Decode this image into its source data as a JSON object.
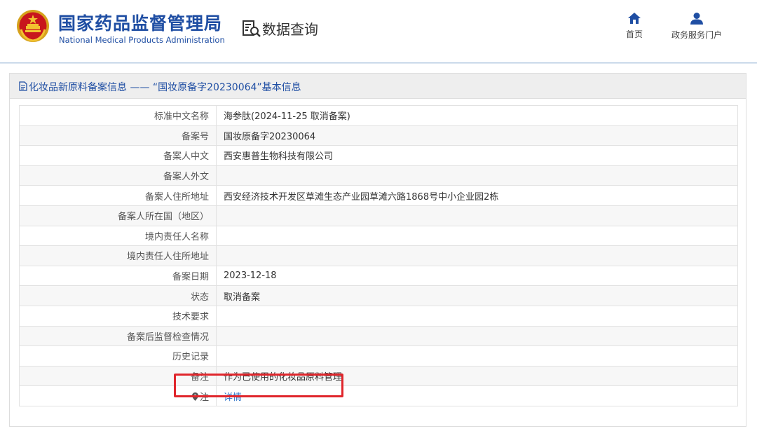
{
  "header": {
    "agency_name_cn": "国家药品监督管理局",
    "agency_name_en": "National Medical Products Administration",
    "section_title": "数据查询",
    "nav": [
      {
        "label": "首页",
        "icon": "home-icon"
      },
      {
        "label": "政务服务门户",
        "icon": "user-icon"
      }
    ]
  },
  "panel": {
    "title": "化妆品新原料备案信息 —— “国妆原备字20230064”基本信息",
    "rows": [
      {
        "label": "标准中文名称",
        "value": "海参肽(2024-11-25 取消备案)"
      },
      {
        "label": "备案号",
        "value": "国妆原备字20230064"
      },
      {
        "label": "备案人中文",
        "value": "西安惠普生物科技有限公司"
      },
      {
        "label": "备案人外文",
        "value": ""
      },
      {
        "label": "备案人住所地址",
        "value": "西安经济技术开发区草滩生态产业园草滩六路1868号中小企业园2栋"
      },
      {
        "label": "备案人所在国（地区）",
        "value": ""
      },
      {
        "label": "境内责任人名称",
        "value": ""
      },
      {
        "label": "境内责任人住所地址",
        "value": ""
      },
      {
        "label": "备案日期",
        "value": "2023-12-18"
      },
      {
        "label": "状态",
        "value": "取消备案"
      },
      {
        "label": "技术要求",
        "value": ""
      },
      {
        "label": "备案后监督检查情况",
        "value": ""
      },
      {
        "label": "历史记录",
        "value": ""
      },
      {
        "label": "备注",
        "value": "作为已使用的化妆品原料管理"
      }
    ],
    "note_row": {
      "label": "注",
      "link_text": "详情",
      "icon": "pin-icon"
    }
  },
  "colors": {
    "brand_blue": "#1f4ea3",
    "link_blue": "#2a72c8",
    "highlight_red": "#e0262c"
  }
}
